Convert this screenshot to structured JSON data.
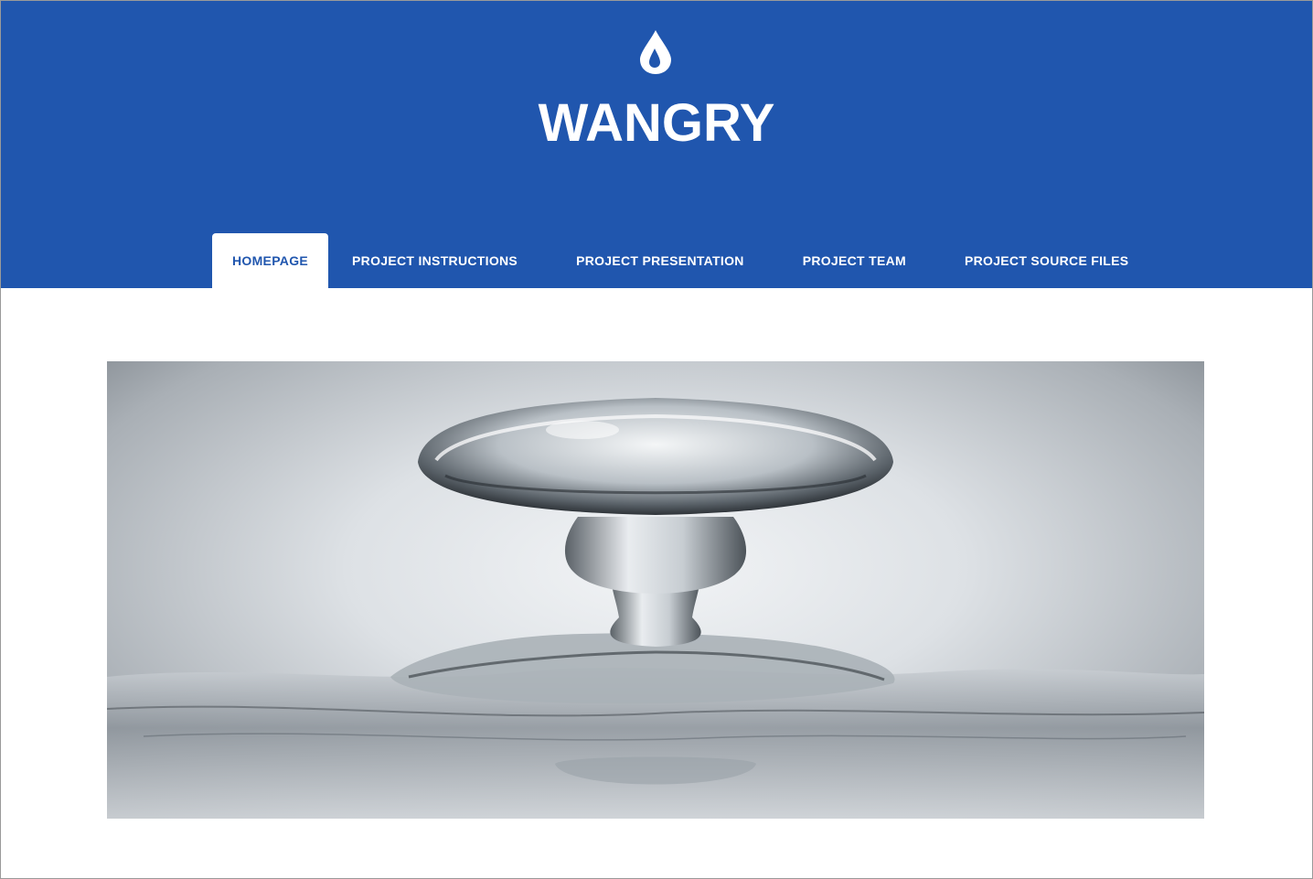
{
  "site": {
    "title": "WANGRY",
    "logo_icon": "water-drop-icon"
  },
  "nav": {
    "items": [
      {
        "label": "HOMEPAGE",
        "active": true
      },
      {
        "label": "PROJECT INSTRUCTIONS",
        "active": false
      },
      {
        "label": "PROJECT PRESENTATION",
        "active": false
      },
      {
        "label": "PROJECT TEAM",
        "active": false
      },
      {
        "label": "PROJECT SOURCE FILES",
        "active": false
      }
    ]
  },
  "hero": {
    "subject": "water-splash-image"
  },
  "colors": {
    "brand": "#2056ae",
    "background": "#ffffff",
    "nav_text": "#ffffff",
    "active_nav_text": "#2056ae"
  }
}
